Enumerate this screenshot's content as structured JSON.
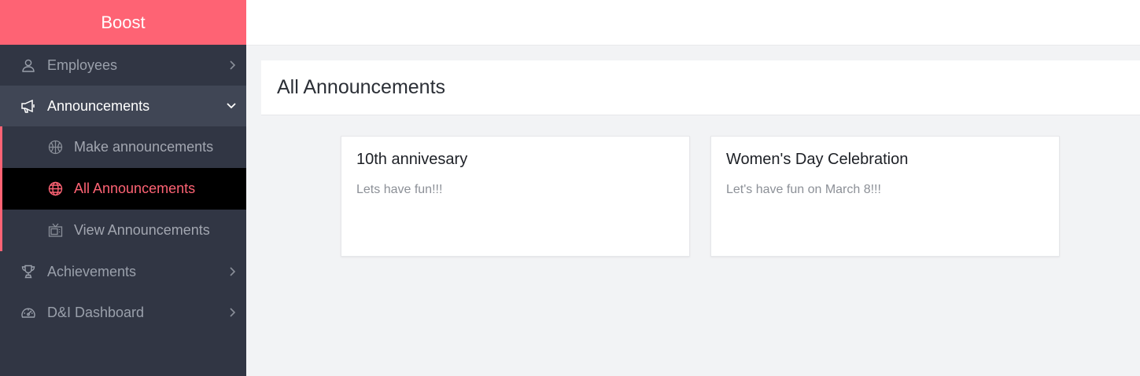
{
  "app": {
    "brand": "Boost"
  },
  "sidebar": {
    "items": [
      {
        "label": "Employees",
        "icon": "user-icon"
      },
      {
        "label": "Announcements",
        "icon": "megaphone-icon",
        "open": true
      },
      {
        "label": "Achievements",
        "icon": "trophy-icon"
      },
      {
        "label": "D&I Dashboard",
        "icon": "speedometer-icon"
      }
    ],
    "announcements_submenu": [
      {
        "label": "Make announcements",
        "icon": "basketball-icon"
      },
      {
        "label": "All Announcements",
        "icon": "globe-icon",
        "active": true
      },
      {
        "label": "View Announcements",
        "icon": "tv-icon"
      }
    ]
  },
  "main": {
    "title": "All Announcements",
    "cards": [
      {
        "title": "10th annivesary",
        "body": "Lets have fun!!!"
      },
      {
        "title": "Women's Day Celebration",
        "body": "Let's have fun on March 8!!!"
      }
    ]
  },
  "colors": {
    "accent": "#fe6374",
    "sidebar": "#313644",
    "sidebar_open": "#404655",
    "active_bg": "#000000"
  }
}
